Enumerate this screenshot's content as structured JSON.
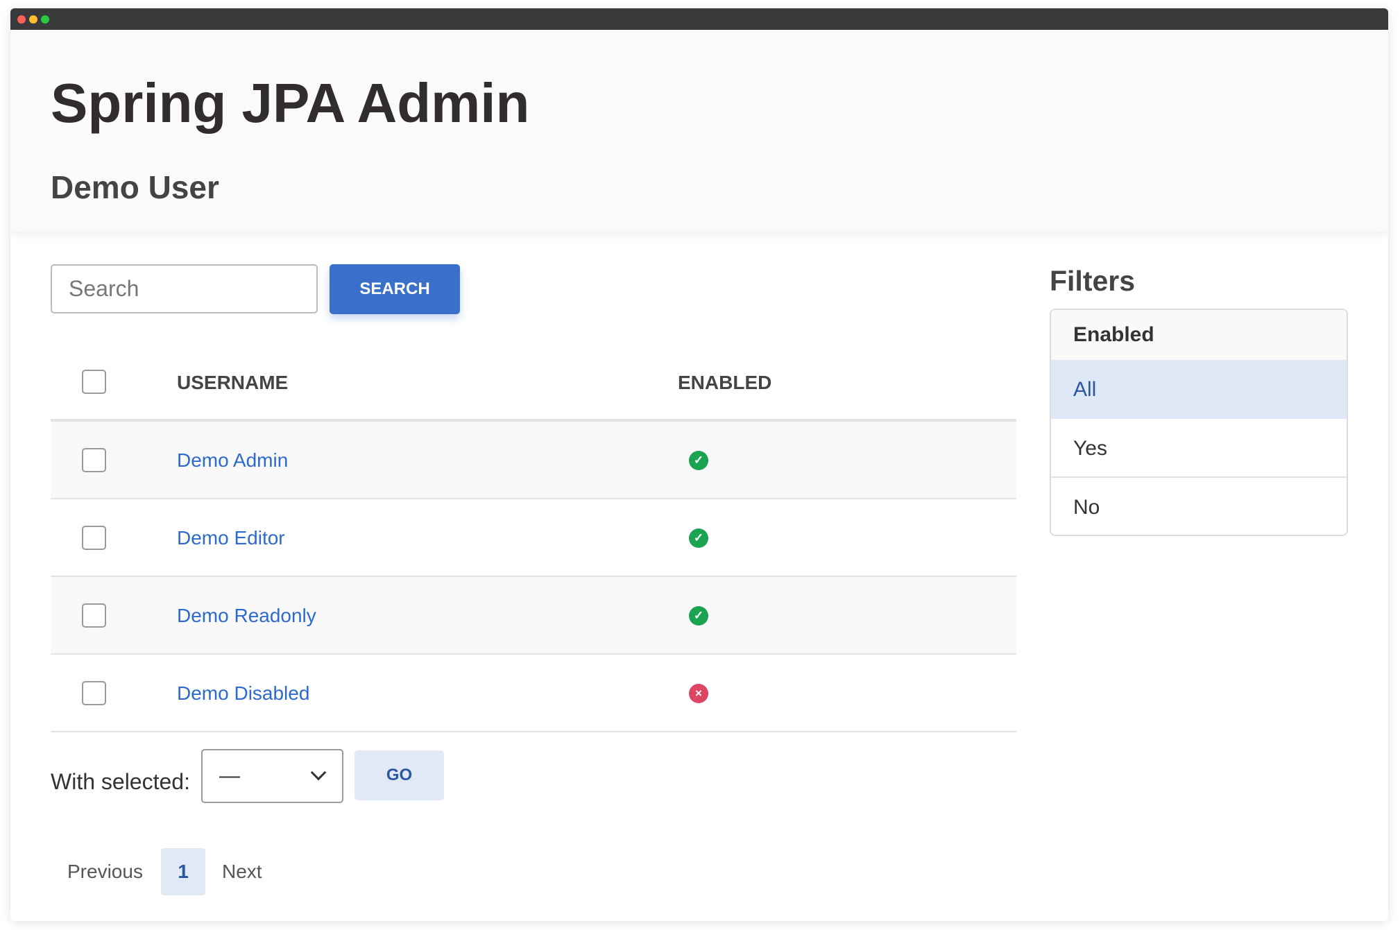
{
  "window": {
    "controls": [
      "close",
      "minimize",
      "maximize"
    ]
  },
  "header": {
    "title": "Spring JPA Admin",
    "subtitle": "Demo User"
  },
  "search": {
    "placeholder": "Search",
    "value": "",
    "button_label": "SEARCH"
  },
  "table": {
    "columns": [
      "USERNAME",
      "ENABLED"
    ],
    "rows": [
      {
        "username": "Demo Admin",
        "enabled": true,
        "icon": "check-circle-icon"
      },
      {
        "username": "Demo Editor",
        "enabled": true,
        "icon": "check-circle-icon"
      },
      {
        "username": "Demo Readonly",
        "enabled": true,
        "icon": "check-circle-icon"
      },
      {
        "username": "Demo Disabled",
        "enabled": false,
        "icon": "x-circle-icon"
      }
    ]
  },
  "bulk": {
    "label": "With selected:",
    "selected": "—",
    "go_label": "GO"
  },
  "pagination": {
    "previous": "Previous",
    "current": "1",
    "next": "Next"
  },
  "filters": {
    "title": "Filters",
    "group": "Enabled",
    "options": [
      "All",
      "Yes",
      "No"
    ],
    "active": "All"
  },
  "colors": {
    "primary": "#3a70c9",
    "link": "#2d6acb",
    "success": "#1aa350",
    "danger": "#dc4563",
    "active_bg": "#dfe8f6"
  }
}
